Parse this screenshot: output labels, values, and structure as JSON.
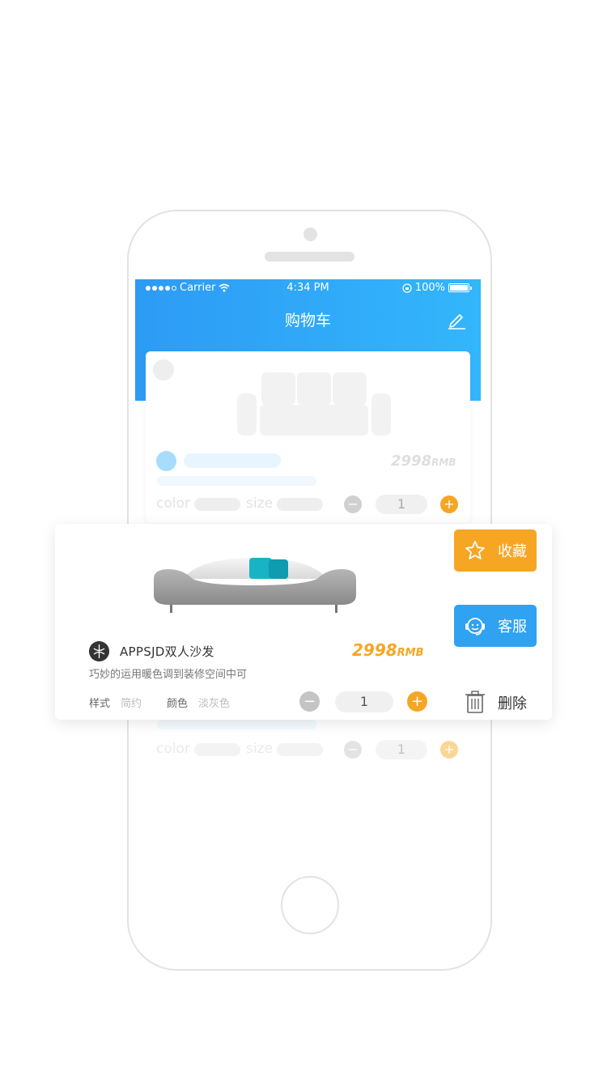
{
  "status_bar": {
    "carrier": "Carrier",
    "time": "4:34 PM",
    "battery": "100%"
  },
  "nav": {
    "title": "购物车",
    "edit_icon": "edit-pen-icon"
  },
  "ghost_card": {
    "price": "2998",
    "price_unit": "RMB",
    "color_label": "color",
    "size_label": "size",
    "quantity": "1"
  },
  "ghost_card_bottom": {
    "color_label": "color",
    "size_label": "size",
    "quantity": "1"
  },
  "product": {
    "name": "APPSJD双人沙发",
    "price": "2998",
    "price_unit": "RMB",
    "description": "巧妙的运用暖色调到装修空间中可",
    "style_label": "样式",
    "style_value": "简约",
    "color_label": "颜色",
    "color_value": "淡灰色",
    "quantity": "1",
    "minus": "−",
    "plus": "+"
  },
  "actions": {
    "favorite_label": "收藏",
    "service_label": "客服",
    "delete_label": "删除"
  },
  "colors": {
    "header_start": "#2d9bf5",
    "header_end": "#33b6fb",
    "accent_orange": "#f6a623",
    "accent_blue": "#2fa2f2"
  }
}
